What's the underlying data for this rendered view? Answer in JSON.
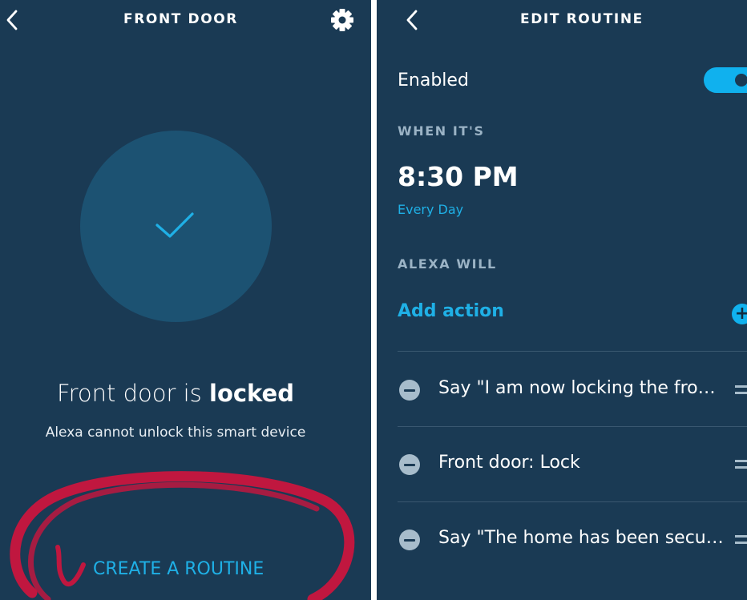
{
  "left": {
    "title": "FRONT DOOR",
    "status_prefix": "Front door is ",
    "status_state": "locked",
    "subtext": "Alexa cannot unlock this smart device",
    "create_routine": "CREATE A ROUTINE",
    "icons": [
      "back-chevron-icon",
      "gear-icon",
      "checkmark-icon"
    ]
  },
  "right": {
    "title": "EDIT ROUTINE",
    "enabled_label": "Enabled",
    "enabled": true,
    "when_heading": "WHEN IT'S",
    "time": "8:30 PM",
    "frequency": "Every Day",
    "alexa_heading": "ALEXA WILL",
    "add_action": "Add action",
    "actions": [
      {
        "label": "Say \"I am now locking the fro…"
      },
      {
        "label": "Front door: Lock"
      },
      {
        "label": "Say \"The home has been secu…"
      }
    ],
    "icons": [
      "back-chevron-icon",
      "plus-icon",
      "remove-icon",
      "drag-handle-icon"
    ]
  },
  "colors": {
    "background": "#1a3a54",
    "circle": "#1c5272",
    "accent": "#1fb0e6",
    "annotation": "#c0173f"
  }
}
